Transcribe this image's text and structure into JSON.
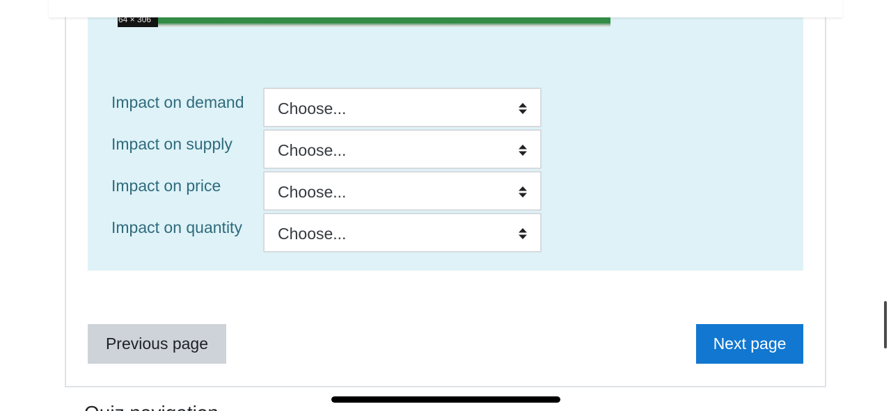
{
  "image": {
    "dimension_badge": "64 × 306"
  },
  "questions": [
    {
      "label": "Impact on demand",
      "selected": "Choose..."
    },
    {
      "label": "Impact on supply",
      "selected": "Choose..."
    },
    {
      "label": "Impact on price",
      "selected": "Choose..."
    },
    {
      "label": "Impact on quantity",
      "selected": "Choose..."
    }
  ],
  "navigation": {
    "previous_label": "Previous page",
    "next_label": "Next page"
  },
  "below_card": {
    "heading_partial": "Quiz navigation"
  },
  "colors": {
    "panel_bg": "#def2f8",
    "label": "#2f6b7c",
    "primary": "#1177d1",
    "secondary": "#ced3d9"
  }
}
